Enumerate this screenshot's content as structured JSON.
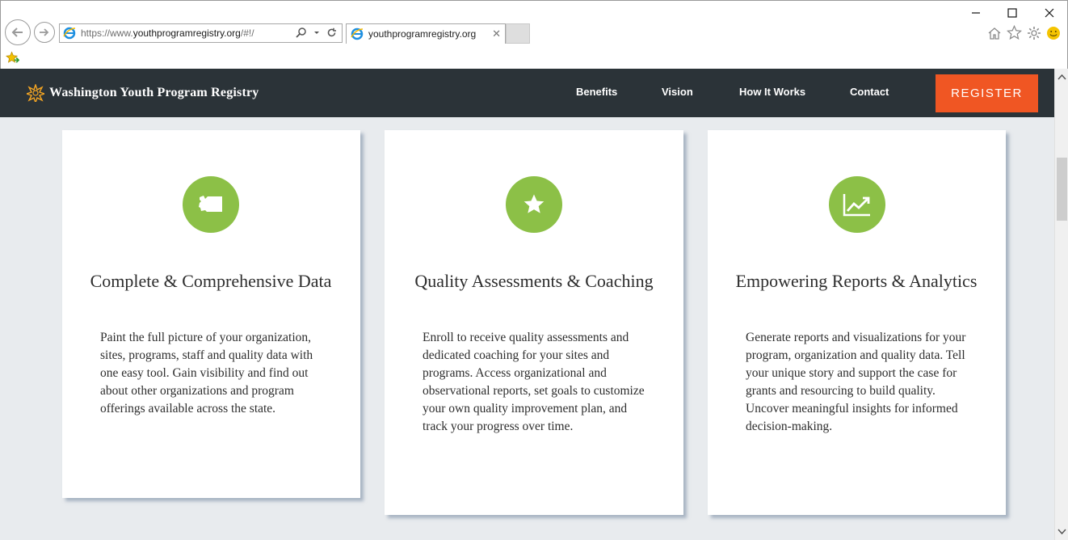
{
  "browser": {
    "address_url_prefix": "https://www.",
    "address_url_domain": "youthprogramregistry.org",
    "address_url_suffix": "/#!/",
    "tab_title": "youthprogramregistry.org",
    "tab_close": "✕",
    "window_minimize": "—",
    "window_maximize": "☐",
    "window_close": "✕"
  },
  "site": {
    "brand_name": "Washington Youth Program Registry",
    "nav": [
      "Benefits",
      "Vision",
      "How It Works",
      "Contact"
    ],
    "register_label": "REGISTER",
    "accent_color": "#f05623",
    "icon_color": "#8cc047",
    "header_color": "#2b3338"
  },
  "cards": [
    {
      "icon": "washington-state-icon",
      "title": "Complete & Comprehensive Data",
      "body": "Paint the full picture of your organization, sites, programs, staff and quality data with one easy tool. Gain visibility and find out about other organizations and program offerings available across the state."
    },
    {
      "icon": "star-icon",
      "title": "Quality Assessments & Coaching",
      "body": "Enroll to receive quality assessments and dedicated coaching for your sites and programs. Access organizational and observational reports, set goals to customize your own quality improvement plan, and track your progress over time."
    },
    {
      "icon": "chart-trend-icon",
      "title": "Empowering Reports & Analytics",
      "body": "Generate reports and visualizations for your program, organization and quality data. Tell your unique story and support the case for grants and resourcing to build quality. Uncover meaningful insights for informed decision-making."
    }
  ]
}
